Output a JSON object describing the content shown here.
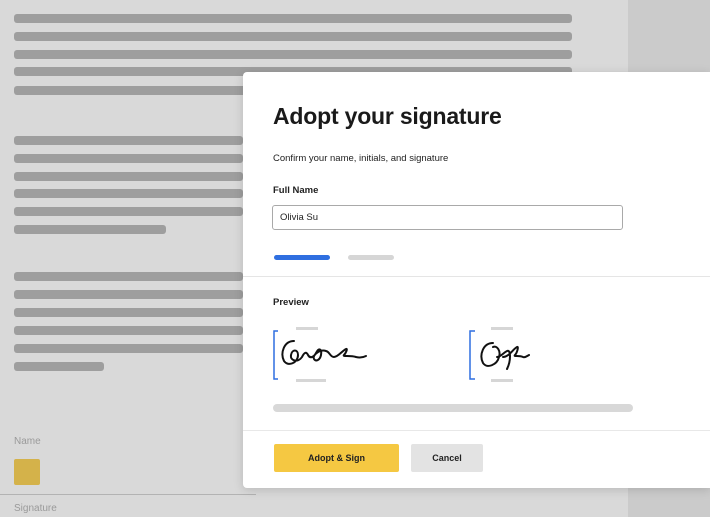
{
  "dialog": {
    "title": "Adopt your signature",
    "subtitle": "Confirm your name, initials, and signature",
    "full_name_label": "Full Name",
    "full_name_value": "Olivia Su",
    "preview_label": "Preview",
    "adopt_button": "Adopt & Sign",
    "cancel_button": "Cancel"
  },
  "document": {
    "name_label": "Name",
    "signature_label": "Signature"
  },
  "colors": {
    "accent_blue": "#2f6fe0",
    "primary_button": "#f5c842",
    "secondary_button": "#e3e3e3"
  }
}
